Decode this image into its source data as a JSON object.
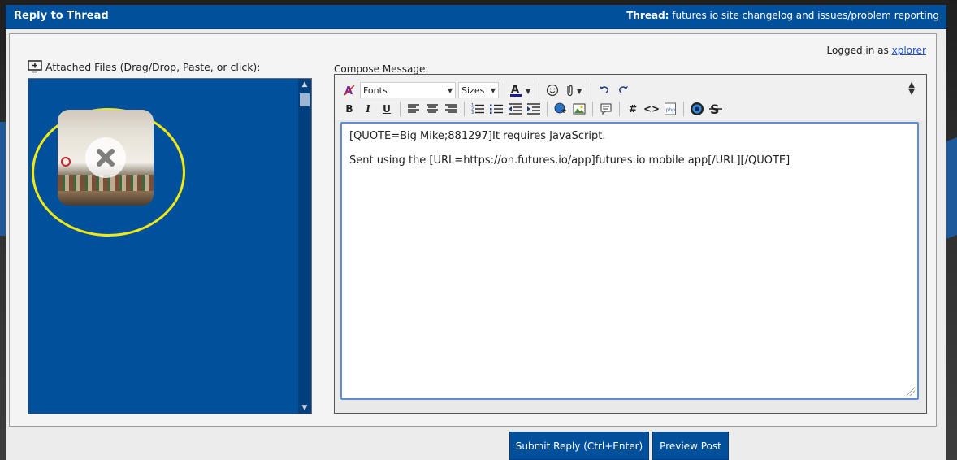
{
  "header": {
    "title": "Reply to Thread",
    "thread_label": "Thread:",
    "thread_name": "futures io site changelog and issues/problem reporting"
  },
  "user": {
    "logged_in_prefix": "Logged in as",
    "username": "xplorer"
  },
  "attachments": {
    "label": "Attached Files (Drag/Drop, Paste, or click):",
    "files": [
      {
        "icon": "photo-thumbnail",
        "remove_icon": "close-icon"
      }
    ]
  },
  "editor": {
    "compose_label": "Compose Message:",
    "font_select": "Fonts",
    "size_select": "Sizes",
    "toolbar_icons": [
      "remove-format-icon",
      "font-color-icon",
      "smiley-icon",
      "attach-icon",
      "undo-icon",
      "redo-icon",
      "bold-icon",
      "italic-icon",
      "underline-icon",
      "align-left-icon",
      "align-center-icon",
      "align-right-icon",
      "ordered-list-icon",
      "unordered-list-icon",
      "outdent-icon",
      "indent-icon",
      "link-icon",
      "image-icon",
      "quote-icon",
      "hash-icon",
      "code-icon",
      "php-icon",
      "video-icon",
      "strike-icon"
    ],
    "lines": [
      "[QUOTE=Big Mike;881297]It requires JavaScript.",
      "Sent using the [URL=https://on.futures.io/app]futures.io mobile app[/URL][/QUOTE]"
    ]
  },
  "buttons": {
    "submit": "Submit Reply (Ctrl+Enter)",
    "preview": "Preview Post"
  },
  "colors": {
    "accent": "#00509c",
    "highlight_ring": "#f1ea12",
    "link": "#1a4fd6"
  }
}
